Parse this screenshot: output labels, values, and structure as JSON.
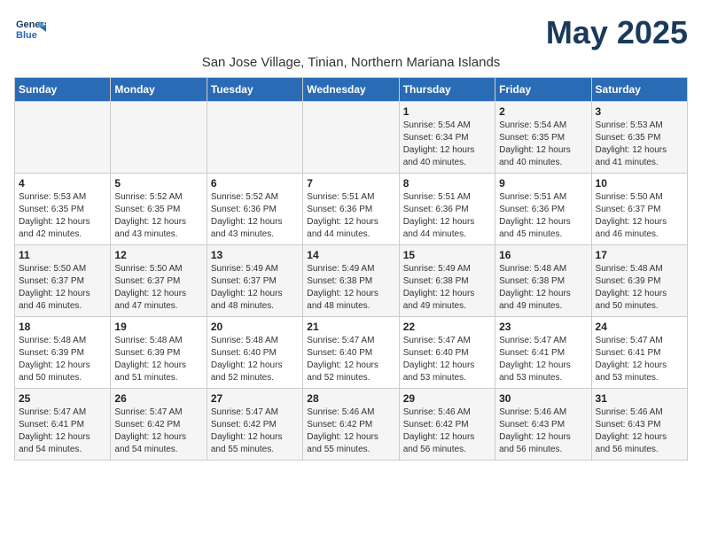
{
  "logo": {
    "line1": "General",
    "line2": "Blue"
  },
  "title": "May 2025",
  "subtitle": "San Jose Village, Tinian, Northern Mariana Islands",
  "weekdays": [
    "Sunday",
    "Monday",
    "Tuesday",
    "Wednesday",
    "Thursday",
    "Friday",
    "Saturday"
  ],
  "weeks": [
    [
      {
        "day": "",
        "info": ""
      },
      {
        "day": "",
        "info": ""
      },
      {
        "day": "",
        "info": ""
      },
      {
        "day": "",
        "info": ""
      },
      {
        "day": "1",
        "info": "Sunrise: 5:54 AM\nSunset: 6:34 PM\nDaylight: 12 hours\nand 40 minutes."
      },
      {
        "day": "2",
        "info": "Sunrise: 5:54 AM\nSunset: 6:35 PM\nDaylight: 12 hours\nand 40 minutes."
      },
      {
        "day": "3",
        "info": "Sunrise: 5:53 AM\nSunset: 6:35 PM\nDaylight: 12 hours\nand 41 minutes."
      }
    ],
    [
      {
        "day": "4",
        "info": "Sunrise: 5:53 AM\nSunset: 6:35 PM\nDaylight: 12 hours\nand 42 minutes."
      },
      {
        "day": "5",
        "info": "Sunrise: 5:52 AM\nSunset: 6:35 PM\nDaylight: 12 hours\nand 43 minutes."
      },
      {
        "day": "6",
        "info": "Sunrise: 5:52 AM\nSunset: 6:36 PM\nDaylight: 12 hours\nand 43 minutes."
      },
      {
        "day": "7",
        "info": "Sunrise: 5:51 AM\nSunset: 6:36 PM\nDaylight: 12 hours\nand 44 minutes."
      },
      {
        "day": "8",
        "info": "Sunrise: 5:51 AM\nSunset: 6:36 PM\nDaylight: 12 hours\nand 44 minutes."
      },
      {
        "day": "9",
        "info": "Sunrise: 5:51 AM\nSunset: 6:36 PM\nDaylight: 12 hours\nand 45 minutes."
      },
      {
        "day": "10",
        "info": "Sunrise: 5:50 AM\nSunset: 6:37 PM\nDaylight: 12 hours\nand 46 minutes."
      }
    ],
    [
      {
        "day": "11",
        "info": "Sunrise: 5:50 AM\nSunset: 6:37 PM\nDaylight: 12 hours\nand 46 minutes."
      },
      {
        "day": "12",
        "info": "Sunrise: 5:50 AM\nSunset: 6:37 PM\nDaylight: 12 hours\nand 47 minutes."
      },
      {
        "day": "13",
        "info": "Sunrise: 5:49 AM\nSunset: 6:37 PM\nDaylight: 12 hours\nand 48 minutes."
      },
      {
        "day": "14",
        "info": "Sunrise: 5:49 AM\nSunset: 6:38 PM\nDaylight: 12 hours\nand 48 minutes."
      },
      {
        "day": "15",
        "info": "Sunrise: 5:49 AM\nSunset: 6:38 PM\nDaylight: 12 hours\nand 49 minutes."
      },
      {
        "day": "16",
        "info": "Sunrise: 5:48 AM\nSunset: 6:38 PM\nDaylight: 12 hours\nand 49 minutes."
      },
      {
        "day": "17",
        "info": "Sunrise: 5:48 AM\nSunset: 6:39 PM\nDaylight: 12 hours\nand 50 minutes."
      }
    ],
    [
      {
        "day": "18",
        "info": "Sunrise: 5:48 AM\nSunset: 6:39 PM\nDaylight: 12 hours\nand 50 minutes."
      },
      {
        "day": "19",
        "info": "Sunrise: 5:48 AM\nSunset: 6:39 PM\nDaylight: 12 hours\nand 51 minutes."
      },
      {
        "day": "20",
        "info": "Sunrise: 5:48 AM\nSunset: 6:40 PM\nDaylight: 12 hours\nand 52 minutes."
      },
      {
        "day": "21",
        "info": "Sunrise: 5:47 AM\nSunset: 6:40 PM\nDaylight: 12 hours\nand 52 minutes."
      },
      {
        "day": "22",
        "info": "Sunrise: 5:47 AM\nSunset: 6:40 PM\nDaylight: 12 hours\nand 53 minutes."
      },
      {
        "day": "23",
        "info": "Sunrise: 5:47 AM\nSunset: 6:41 PM\nDaylight: 12 hours\nand 53 minutes."
      },
      {
        "day": "24",
        "info": "Sunrise: 5:47 AM\nSunset: 6:41 PM\nDaylight: 12 hours\nand 53 minutes."
      }
    ],
    [
      {
        "day": "25",
        "info": "Sunrise: 5:47 AM\nSunset: 6:41 PM\nDaylight: 12 hours\nand 54 minutes."
      },
      {
        "day": "26",
        "info": "Sunrise: 5:47 AM\nSunset: 6:42 PM\nDaylight: 12 hours\nand 54 minutes."
      },
      {
        "day": "27",
        "info": "Sunrise: 5:47 AM\nSunset: 6:42 PM\nDaylight: 12 hours\nand 55 minutes."
      },
      {
        "day": "28",
        "info": "Sunrise: 5:46 AM\nSunset: 6:42 PM\nDaylight: 12 hours\nand 55 minutes."
      },
      {
        "day": "29",
        "info": "Sunrise: 5:46 AM\nSunset: 6:42 PM\nDaylight: 12 hours\nand 56 minutes."
      },
      {
        "day": "30",
        "info": "Sunrise: 5:46 AM\nSunset: 6:43 PM\nDaylight: 12 hours\nand 56 minutes."
      },
      {
        "day": "31",
        "info": "Sunrise: 5:46 AM\nSunset: 6:43 PM\nDaylight: 12 hours\nand 56 minutes."
      }
    ]
  ]
}
